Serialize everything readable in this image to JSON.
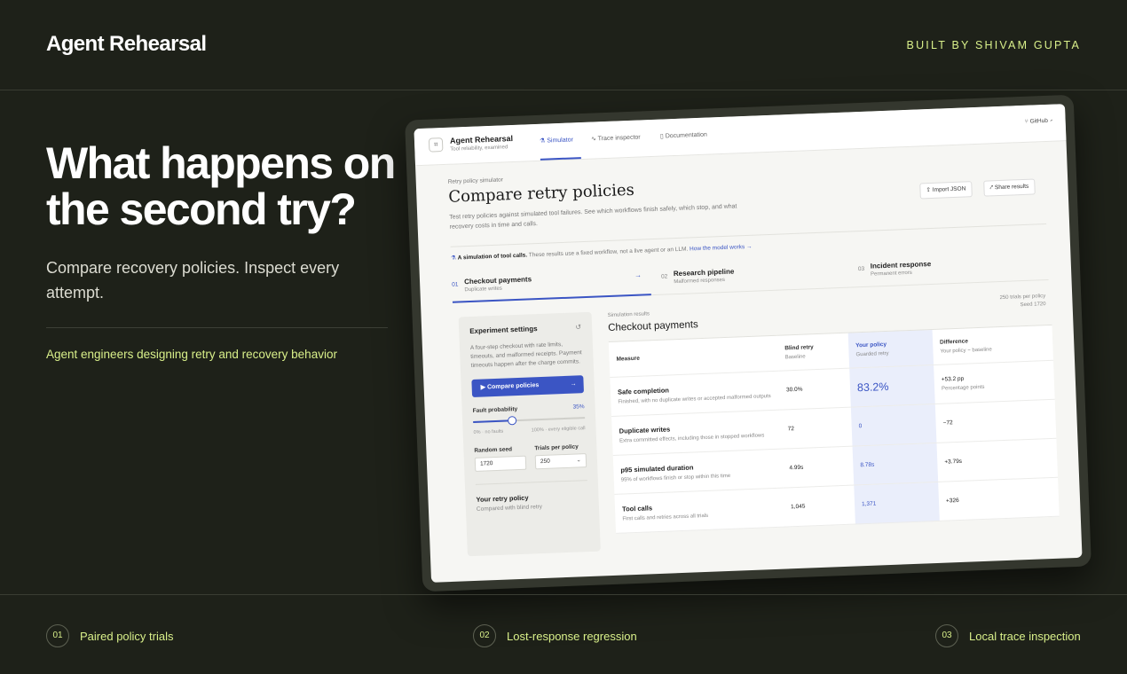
{
  "header": {
    "brand": "Agent Rehearsal",
    "credit": "BUILT BY SHIVAM GUPTA"
  },
  "hero": {
    "headline": "What happens on the second try?",
    "subline": "Compare recovery policies. Inspect every attempt.",
    "audience": "Agent engineers designing retry and recovery behavior"
  },
  "app": {
    "brand": "Agent Rehearsal",
    "brand_sub": "Tool reliability, examined",
    "nav": [
      {
        "label": "Simulator",
        "icon": "flask-icon"
      },
      {
        "label": "Trace inspector",
        "icon": "pulse-icon"
      },
      {
        "label": "Documentation",
        "icon": "book-icon"
      }
    ],
    "github": "GitHub",
    "eyebrow": "Retry policy simulator",
    "title": "Compare retry policies",
    "description": "Test retry policies against simulated tool failures. See which workflows finish safely, which stop, and what recovery costs in time and calls.",
    "buttons": {
      "import": "Import JSON",
      "share": "Share results"
    },
    "note": {
      "bold": "A simulation of tool calls.",
      "text": "These results use a fixed workflow, not a live agent or an LLM.",
      "link": "How the model works"
    },
    "steps": [
      {
        "num": "01",
        "title": "Checkout payments",
        "sub": "Duplicate writes"
      },
      {
        "num": "02",
        "title": "Research pipeline",
        "sub": "Malformed responses"
      },
      {
        "num": "03",
        "title": "Incident response",
        "sub": "Permanent errors"
      }
    ],
    "settings": {
      "title": "Experiment settings",
      "desc": "A four-step checkout with rate limits, timeouts, and malformed receipts. Payment timeouts happen after the charge commits.",
      "compare": "Compare policies",
      "fault_label": "Fault probability",
      "fault_value": "35%",
      "fault_fraction": 0.35,
      "fault_min": "0% · no faults",
      "fault_max": "100% · every eligible call",
      "seed_label": "Random seed",
      "seed_value": "1720",
      "trials_label": "Trials per policy",
      "trials_value": "250",
      "policy_title": "Your retry policy",
      "policy_sub": "Compared with blind retry"
    },
    "results": {
      "eyebrow": "Simulation results",
      "title": "Checkout payments",
      "trials": "250 trials per policy",
      "seed": "Seed 1720",
      "columns": [
        {
          "title": "Measure",
          "sub": ""
        },
        {
          "title": "Blind retry",
          "sub": "Baseline"
        },
        {
          "title": "Your policy",
          "sub": "Guarded retry"
        },
        {
          "title": "Difference",
          "sub": "Your policy − baseline"
        }
      ],
      "rows": [
        {
          "name": "Safe completion",
          "desc": "Finished, with no duplicate writes or accepted malformed outputs",
          "blind": "30.0%",
          "yours": "83.2%",
          "diff": "+53.2 pp",
          "diff_sub": "Percentage points"
        },
        {
          "name": "Duplicate writes",
          "desc": "Extra committed effects, including those in stopped workflows",
          "blind": "72",
          "yours": "0",
          "diff": "−72",
          "diff_sub": ""
        },
        {
          "name": "p95 simulated duration",
          "desc": "95% of workflows finish or stop within this time",
          "blind": "4.99s",
          "yours": "8.78s",
          "diff": "+3.79s",
          "diff_sub": ""
        },
        {
          "name": "Tool calls",
          "desc": "First calls and retries across all trials",
          "blind": "1,045",
          "yours": "1,371",
          "diff": "+326",
          "diff_sub": ""
        }
      ]
    }
  },
  "features": [
    {
      "num": "01",
      "label": "Paired policy trials"
    },
    {
      "num": "02",
      "label": "Lost-response regression"
    },
    {
      "num": "03",
      "label": "Local trace inspection"
    }
  ]
}
